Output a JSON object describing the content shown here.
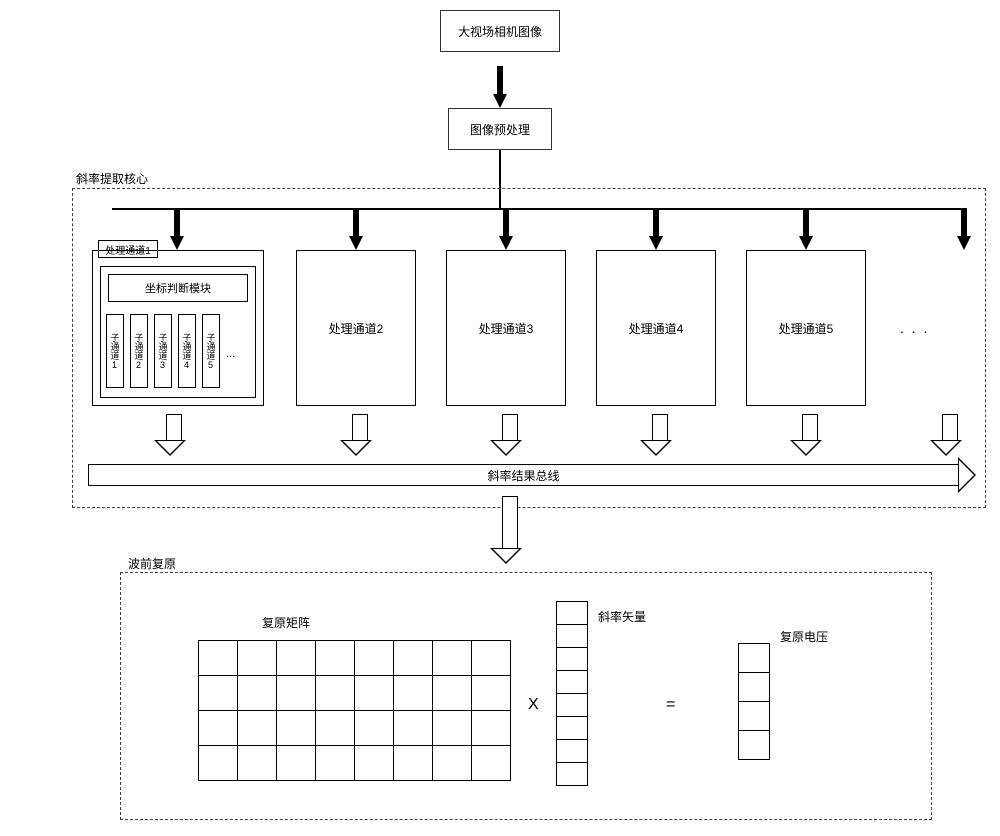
{
  "top": {
    "camera": "大视场相机图像",
    "preprocess": "图像预处理"
  },
  "slope_core": {
    "title": "斜率提取核心",
    "channel1_tag": "处理通道1",
    "coord_module": "坐标判断模块",
    "subchannels": [
      "子通道1",
      "子通道2",
      "子通道3",
      "子通道4",
      "子通道5"
    ],
    "sub_dots": "...",
    "channels": [
      "处理通道2",
      "处理通道3",
      "处理通道4",
      "处理通道5"
    ],
    "ch_dots": ". . .",
    "bus_label": "斜率结果总线"
  },
  "wavefront": {
    "title": "波前复原",
    "matrix_label": "复原矩阵",
    "slope_vector_label": "斜率矢量",
    "voltage_label": "复原电压",
    "op_mult": "X",
    "op_eq": "="
  }
}
